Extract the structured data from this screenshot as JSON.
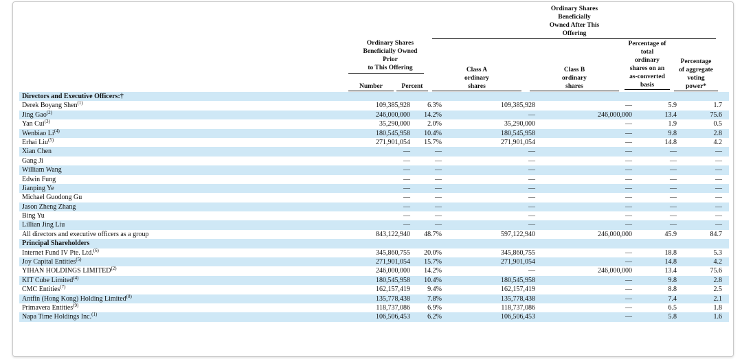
{
  "headers": {
    "prior_group": "Ordinary Shares Beneficially Owned Prior to This Offering",
    "prior_group_lines": [
      "Ordinary Shares",
      "Beneficially Owned",
      "Prior",
      "to This Offering"
    ],
    "after_group_lines": [
      "Ordinary Shares",
      "Beneficially",
      "Owned After This",
      "Offering"
    ],
    "number": "Number",
    "percent": "Percent",
    "class_a": [
      "Class A",
      "ordinary",
      "shares"
    ],
    "class_b": [
      "Class B",
      "ordinary",
      "shares"
    ],
    "pct_total": [
      "Percentage of",
      "total",
      "ordinary",
      "shares on an",
      "as-converted",
      "basis"
    ],
    "pct_voting": [
      "Percentage",
      "of aggregate",
      "voting",
      "power*"
    ]
  },
  "rows": [
    {
      "label": "Directors and Executive Officers:†",
      "section": true,
      "shade": true
    },
    {
      "label": "Derek Boyang Shen",
      "note": "(1)",
      "number": "109,385,928",
      "percent": "6.3%",
      "class_a": "109,385,928",
      "class_b": "—",
      "pct_total": "5.9",
      "pct_voting": "1.7",
      "shade": false
    },
    {
      "label": "Jing Gao",
      "note": "(2)",
      "number": "246,000,000",
      "percent": "14.2%",
      "class_a": "—",
      "class_b": "246,000,000",
      "pct_total": "13.4",
      "pct_voting": "75.6",
      "shade": true
    },
    {
      "label": "Yan Cui",
      "note": "(3)",
      "number": "35,290,000",
      "percent": "2.0%",
      "class_a": "35,290,000",
      "class_b": "—",
      "pct_total": "1.9",
      "pct_voting": "0.5",
      "shade": false
    },
    {
      "label": "Wenbiao Li",
      "note": "(4)",
      "number": "180,545,958",
      "percent": "10.4%",
      "class_a": "180,545,958",
      "class_b": "—",
      "pct_total": "9.8",
      "pct_voting": "2.8",
      "shade": true
    },
    {
      "label": "Erhai Liu",
      "note": "(5)",
      "number": "271,901,054",
      "percent": "15.7%",
      "class_a": "271,901,054",
      "class_b": "—",
      "pct_total": "14.8",
      "pct_voting": "4.2",
      "shade": false
    },
    {
      "label": "Xian Chen",
      "number": "—",
      "percent": "—",
      "class_a": "—",
      "class_b": "—",
      "pct_total": "—",
      "pct_voting": "—",
      "shade": true
    },
    {
      "label": "Gang Ji",
      "number": "—",
      "percent": "—",
      "class_a": "—",
      "class_b": "—",
      "pct_total": "—",
      "pct_voting": "—",
      "shade": false
    },
    {
      "label": "William Wang",
      "number": "—",
      "percent": "—",
      "class_a": "—",
      "class_b": "—",
      "pct_total": "—",
      "pct_voting": "—",
      "shade": true
    },
    {
      "label": "Edwin Fung",
      "number": "—",
      "percent": "—",
      "class_a": "—",
      "class_b": "—",
      "pct_total": "—",
      "pct_voting": "—",
      "shade": false
    },
    {
      "label": "Jianping Ye",
      "number": "—",
      "percent": "—",
      "class_a": "—",
      "class_b": "—",
      "pct_total": "—",
      "pct_voting": "—",
      "shade": true
    },
    {
      "label": "Michael Guodong Gu",
      "number": "—",
      "percent": "—",
      "class_a": "—",
      "class_b": "—",
      "pct_total": "—",
      "pct_voting": "—",
      "shade": false
    },
    {
      "label": "Jason Zheng Zhang",
      "number": "—",
      "percent": "—",
      "class_a": "—",
      "class_b": "—",
      "pct_total": "—",
      "pct_voting": "—",
      "shade": true
    },
    {
      "label": "Bing Yu",
      "number": "—",
      "percent": "—",
      "class_a": "—",
      "class_b": "—",
      "pct_total": "—",
      "pct_voting": "—",
      "shade": false
    },
    {
      "label": "Lillian Jing Liu",
      "number": "—",
      "percent": "—",
      "class_a": "—",
      "class_b": "—",
      "pct_total": "—",
      "pct_voting": "—",
      "shade": true
    },
    {
      "label": "All directors and executive officers as a group",
      "number": "843,122,940",
      "percent": "48.7%",
      "class_a": "597,122,940",
      "class_b": "246,000,000",
      "pct_total": "45.9",
      "pct_voting": "84.7",
      "shade": false
    },
    {
      "label": "Principal Shareholders",
      "section": true,
      "shade": true
    },
    {
      "label": "Internet Fund IV Pte. Ltd.",
      "note": "(6)",
      "number": "345,860,755",
      "percent": "20.0%",
      "class_a": "345,860,755",
      "class_b": "—",
      "pct_total": "18.8",
      "pct_voting": "5.3",
      "shade": false
    },
    {
      "label": "Joy Capital Entities",
      "note": "(5)",
      "number": "271,901,054",
      "percent": "15.7%",
      "class_a": "271,901,054",
      "class_b": "—",
      "pct_total": "14.8",
      "pct_voting": "4.2",
      "shade": true
    },
    {
      "label": "YIHAN HOLDINGS LIMITED",
      "note": "(2)",
      "number": "246,000,000",
      "percent": "14.2%",
      "class_a": "—",
      "class_b": "246,000,000",
      "pct_total": "13.4",
      "pct_voting": "75.6",
      "shade": false
    },
    {
      "label": "KIT Cube Limited",
      "note": "(4)",
      "number": "180,545,958",
      "percent": "10.4%",
      "class_a": "180,545,958",
      "class_b": "—",
      "pct_total": "9.8",
      "pct_voting": "2.8",
      "shade": true
    },
    {
      "label": "CMC Entities",
      "note": "(7)",
      "number": "162,157,419",
      "percent": "9.4%",
      "class_a": "162,157,419",
      "class_b": "—",
      "pct_total": "8.8",
      "pct_voting": "2.5",
      "shade": false
    },
    {
      "label": "Antfin (Hong Kong) Holding Limited",
      "note": "(8)",
      "number": "135,778,438",
      "percent": "7.8%",
      "class_a": "135,778,438",
      "class_b": "—",
      "pct_total": "7.4",
      "pct_voting": "2.1",
      "shade": true
    },
    {
      "label": "Primavera Entities",
      "note": "(9)",
      "number": "118,737,086",
      "percent": "6.9%",
      "class_a": "118,737,086",
      "class_b": "—",
      "pct_total": "6.5",
      "pct_voting": "1.8",
      "shade": false
    },
    {
      "label": "Napa Time Holdings Inc.",
      "note": "(1)",
      "number": "106,506,453",
      "percent": "6.2%",
      "class_a": "106,506,453",
      "class_b": "—",
      "pct_total": "5.8",
      "pct_voting": "1.6",
      "shade": true
    }
  ]
}
